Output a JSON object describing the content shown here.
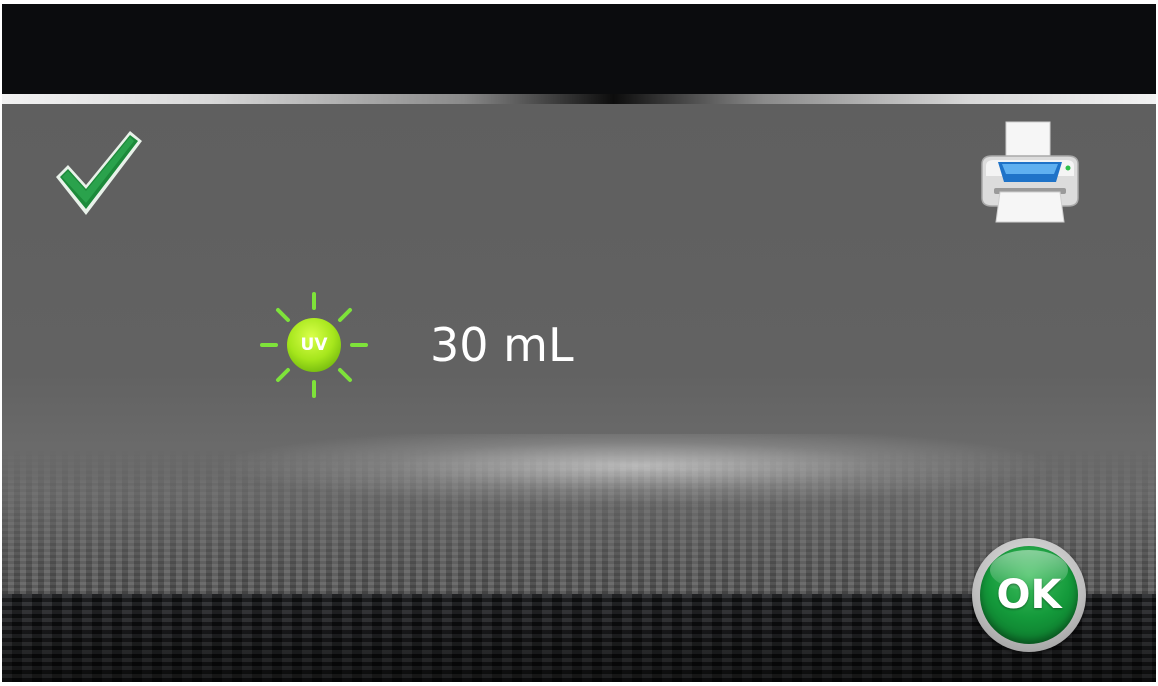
{
  "status": {
    "icon": "checkmark-icon",
    "color": "#1f8a3c"
  },
  "toolbar": {
    "print_icon": "printer-icon"
  },
  "measurement": {
    "uv_label": "UV",
    "uv_icon": "uv-sun-icon",
    "uv_color": "#9be21f",
    "volume": "30 mL"
  },
  "actions": {
    "ok_label": "OK",
    "ok_color": "#149a3b"
  }
}
